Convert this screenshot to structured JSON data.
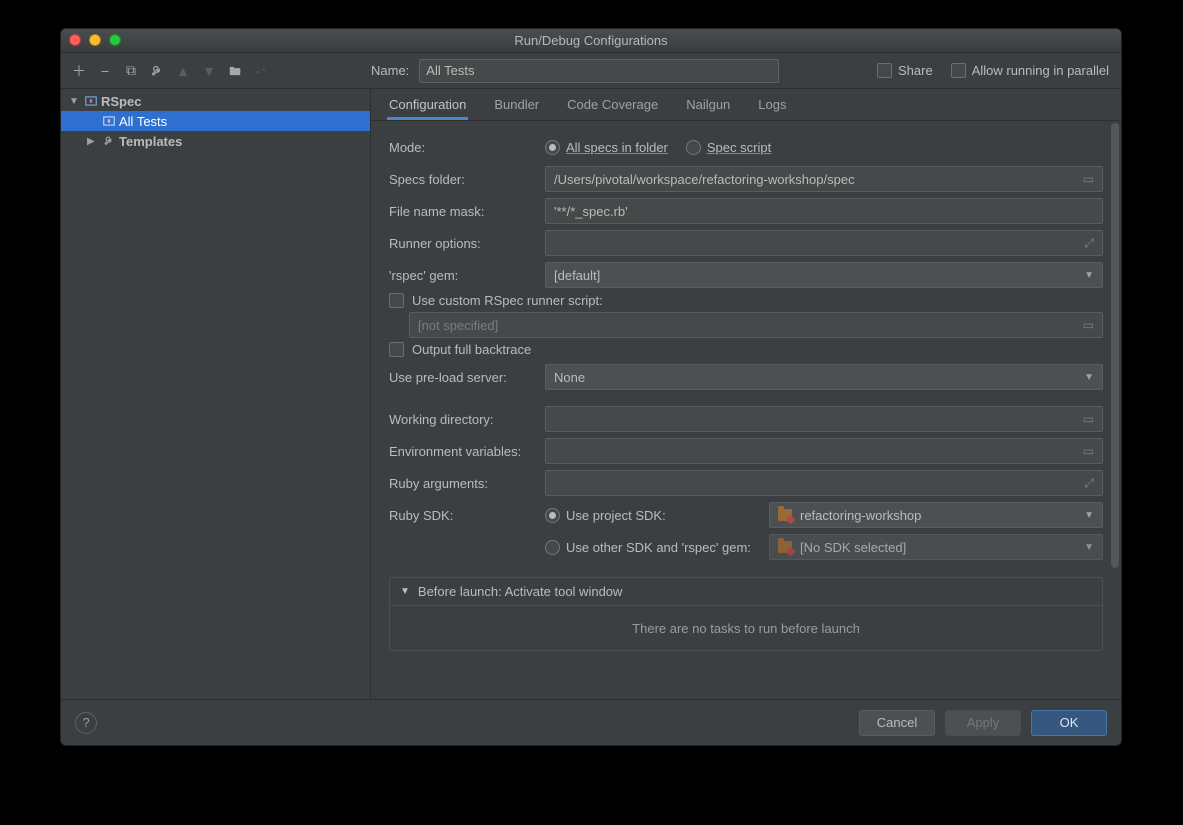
{
  "window": {
    "title": "Run/Debug Configurations"
  },
  "toprow": {
    "name_label": "Name:",
    "name_value": "All Tests",
    "share_label": "Share",
    "parallel_label": "Allow running in parallel"
  },
  "sidebar": {
    "rspec_label": "RSpec",
    "all_tests_label": "All Tests",
    "templates_label": "Templates"
  },
  "tabs": {
    "configuration": "Configuration",
    "bundler": "Bundler",
    "coverage": "Code Coverage",
    "nailgun": "Nailgun",
    "logs": "Logs"
  },
  "form": {
    "mode_label": "Mode:",
    "all_specs_label": "All specs in folder",
    "spec_script_label": "Spec script",
    "specs_folder_label": "Specs folder:",
    "specs_folder_value": "/Users/pivotal/workspace/refactoring-workshop/spec",
    "file_mask_label": "File name mask:",
    "file_mask_value": "'**/*_spec.rb'",
    "runner_opts_label": "Runner options:",
    "runner_opts_value": "",
    "rspec_gem_label": "'rspec' gem:",
    "rspec_gem_value": "[default]",
    "custom_runner_label": "Use custom RSpec runner script:",
    "custom_runner_placeholder": "[not specified]",
    "full_backtrace_label": "Output full backtrace",
    "preload_label": "Use pre-load server:",
    "preload_value": "None",
    "workdir_label": "Working directory:",
    "workdir_value": "",
    "env_label": "Environment variables:",
    "env_value": "",
    "ruby_args_label": "Ruby arguments:",
    "ruby_args_value": "",
    "ruby_sdk_label": "Ruby SDK:",
    "use_project_sdk_label": "Use project SDK:",
    "project_sdk_value": "refactoring-workshop",
    "use_other_sdk_label": "Use other SDK and 'rspec' gem:",
    "other_sdk_value": "[No SDK selected]"
  },
  "before_launch": {
    "header": "Before launch: Activate tool window",
    "empty": "There are no tasks to run before launch"
  },
  "footer": {
    "cancel": "Cancel",
    "apply": "Apply",
    "ok": "OK"
  }
}
